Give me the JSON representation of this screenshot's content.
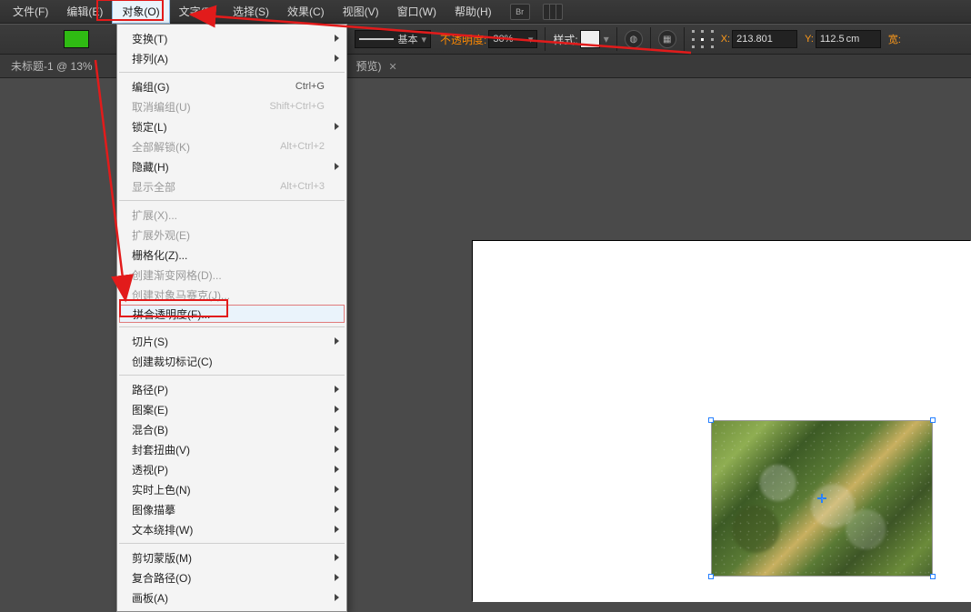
{
  "menubar": {
    "items": [
      {
        "label": "文件(F)"
      },
      {
        "label": "编辑(E)"
      },
      {
        "label": "对象(O)"
      },
      {
        "label": "文字(T)"
      },
      {
        "label": "选择(S)"
      },
      {
        "label": "效果(C)"
      },
      {
        "label": "视图(V)"
      },
      {
        "label": "窗口(W)"
      },
      {
        "label": "帮助(H)"
      }
    ],
    "bridge_icon": "Br"
  },
  "optionsbar": {
    "fill_color": "#2fbb13",
    "stroke_style_label": "基本",
    "opacity_label": "不透明度:",
    "opacity_value": "30%",
    "style_label": "样式:",
    "x_label": "X:",
    "x_value": "213.801",
    "y_label": "Y:",
    "y_value": "112.5",
    "y_unit": "cm",
    "width_label": "宽:"
  },
  "doctabs": {
    "main": "未标题-1 @ 13%",
    "extra": "预览)"
  },
  "dropdown": {
    "items": [
      {
        "label": "变换(T)",
        "submenu": true
      },
      {
        "label": "排列(A)",
        "submenu": true
      },
      {
        "sep": true
      },
      {
        "label": "编组(G)",
        "shortcut": "Ctrl+G"
      },
      {
        "label": "取消编组(U)",
        "shortcut": "Shift+Ctrl+G",
        "disabled": true
      },
      {
        "label": "锁定(L)",
        "submenu": true
      },
      {
        "label": "全部解锁(K)",
        "shortcut": "Alt+Ctrl+2",
        "disabled": true
      },
      {
        "label": "隐藏(H)",
        "submenu": true
      },
      {
        "label": "显示全部",
        "shortcut": "Alt+Ctrl+3",
        "disabled": true
      },
      {
        "sep": true
      },
      {
        "label": "扩展(X)...",
        "disabled": true
      },
      {
        "label": "扩展外观(E)",
        "disabled": true
      },
      {
        "label": "栅格化(Z)..."
      },
      {
        "label": "创建渐变网格(D)...",
        "disabled": true
      },
      {
        "label": "创建对象马赛克(J)...",
        "disabled": true
      },
      {
        "label": "拼合透明度(F)...",
        "highlight": true
      },
      {
        "sep": true
      },
      {
        "label": "切片(S)",
        "submenu": true
      },
      {
        "label": "创建裁切标记(C)"
      },
      {
        "sep": true
      },
      {
        "label": "路径(P)",
        "submenu": true
      },
      {
        "label": "图案(E)",
        "submenu": true
      },
      {
        "label": "混合(B)",
        "submenu": true
      },
      {
        "label": "封套扭曲(V)",
        "submenu": true
      },
      {
        "label": "透视(P)",
        "submenu": true
      },
      {
        "label": "实时上色(N)",
        "submenu": true
      },
      {
        "label": "图像描摹",
        "submenu": true
      },
      {
        "label": "文本绕排(W)",
        "submenu": true
      },
      {
        "sep": true
      },
      {
        "label": "剪切蒙版(M)",
        "submenu": true
      },
      {
        "label": "复合路径(O)",
        "submenu": true
      },
      {
        "label": "画板(A)",
        "submenu": true
      }
    ]
  }
}
